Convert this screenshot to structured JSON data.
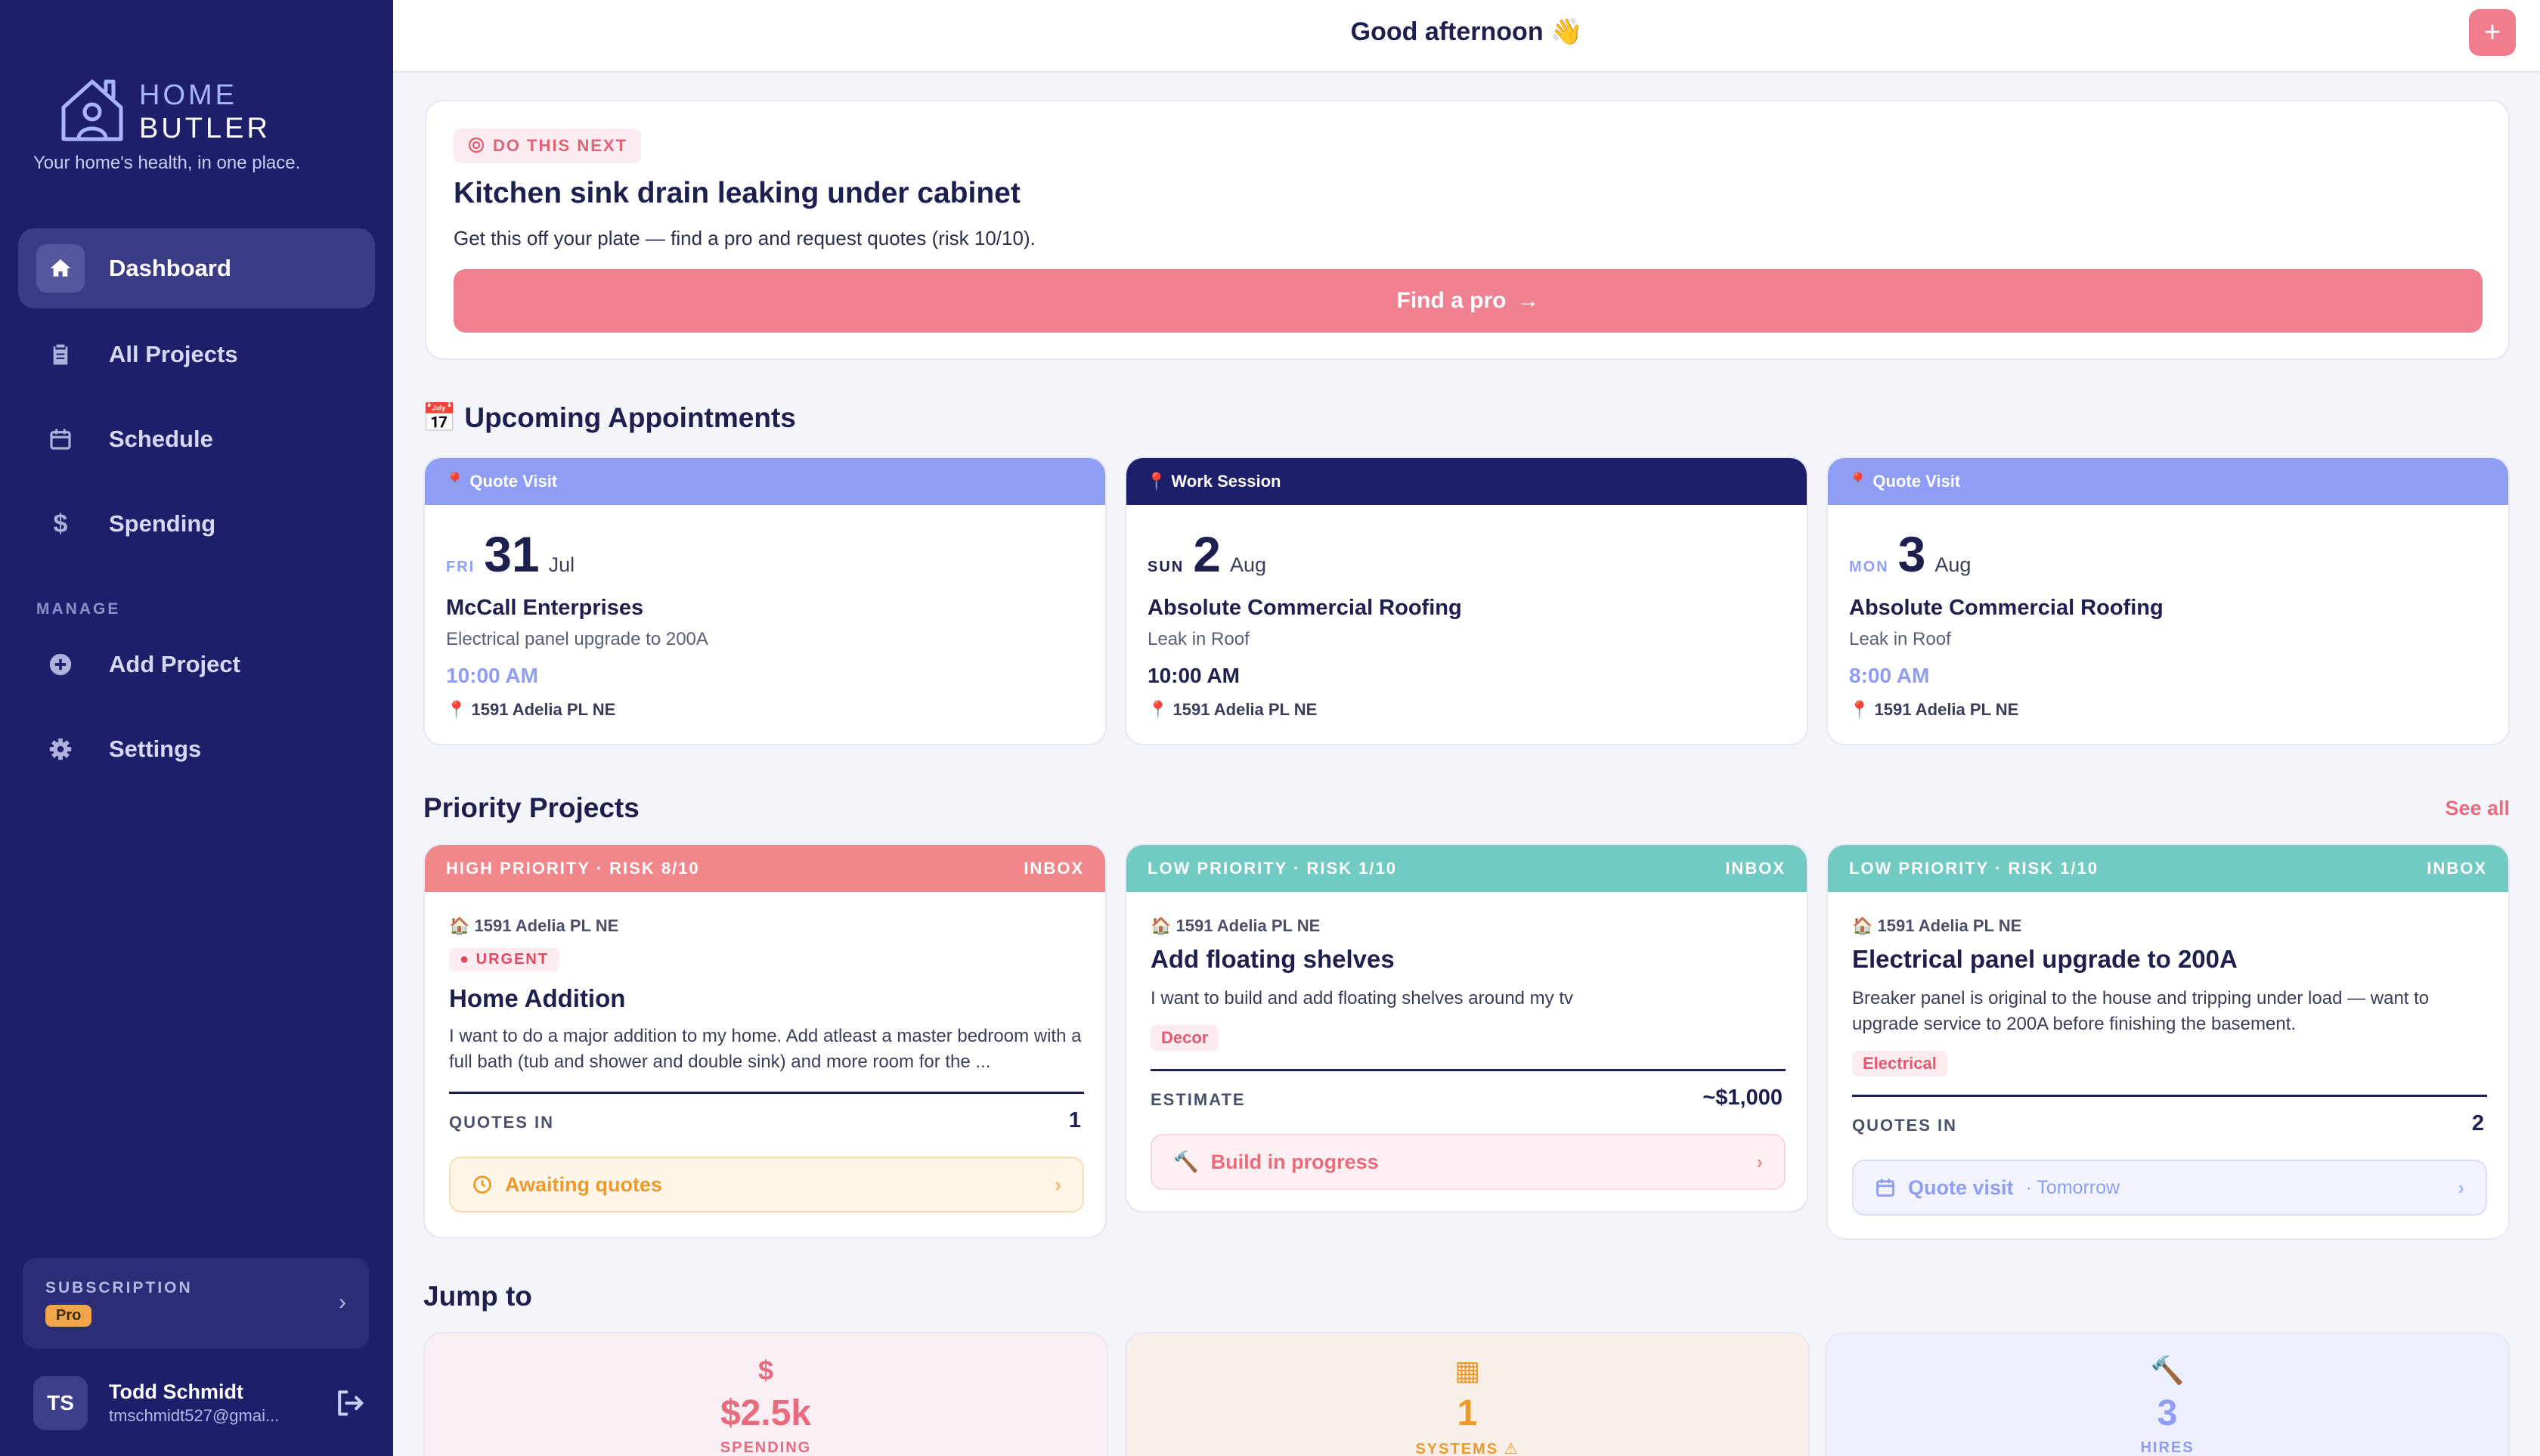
{
  "brand": {
    "line1": "HOME",
    "line2": "BUTLER",
    "tagline": "Your home's health, in one place."
  },
  "nav": {
    "items": [
      {
        "label": "Dashboard",
        "icon": "home-icon"
      },
      {
        "label": "All Projects",
        "icon": "clipboard-icon"
      },
      {
        "label": "Schedule",
        "icon": "calendar-icon"
      },
      {
        "label": "Spending",
        "icon": "dollar-icon"
      }
    ],
    "manage_label": "MANAGE",
    "manage_items": [
      {
        "label": "Add Project",
        "icon": "plus-circle-icon"
      },
      {
        "label": "Settings",
        "icon": "gear-icon"
      }
    ]
  },
  "subscription": {
    "title": "SUBSCRIPTION",
    "plan": "Pro"
  },
  "user": {
    "initials": "TS",
    "name": "Todd Schmidt",
    "email": "tmschmidt527@gmai..."
  },
  "header": {
    "greeting": "Good afternoon 👋",
    "add_label": "+"
  },
  "next": {
    "chip": "DO THIS NEXT",
    "title": "Kitchen sink drain leaking under cabinet",
    "description": "Get this off your plate — find a pro and request quotes (risk 10/10).",
    "button": "Find a pro",
    "button_arrow": "→"
  },
  "appointments": {
    "title": "📅 Upcoming Appointments",
    "items": [
      {
        "type": "Quote Visit",
        "dow": "FRI",
        "day": "31",
        "month": "Jul",
        "company": "McCall Enterprises",
        "project": "Electrical panel upgrade to 200A",
        "time": "10:00 AM",
        "address": "1591 Adelia PL NE"
      },
      {
        "type": "Work Session",
        "dow": "SUN",
        "day": "2",
        "month": "Aug",
        "company": "Absolute Commercial Roofing",
        "project": "Leak in Roof",
        "time": "10:00 AM",
        "address": "1591 Adelia PL NE"
      },
      {
        "type": "Quote Visit",
        "dow": "MON",
        "day": "3",
        "month": "Aug",
        "company": "Absolute Commercial Roofing",
        "project": "Leak in Roof",
        "time": "8:00 AM",
        "address": "1591 Adelia PL NE"
      }
    ]
  },
  "projects": {
    "title": "Priority Projects",
    "see_all": "See all",
    "items": [
      {
        "priority": "HIGH PRIORITY · RISK 8/10",
        "stage": "INBOX",
        "address": "1591 Adelia PL NE",
        "urgent": "URGENT",
        "title": "Home Addition",
        "description": "I want to do a major addition to my home. Add atleast a master bedroom with a full bath (tub and shower and double sink) and more room for the ...",
        "kv_label": "QUOTES IN",
        "kv_value": "1",
        "status": "Awaiting quotes"
      },
      {
        "priority": "LOW PRIORITY · RISK 1/10",
        "stage": "INBOX",
        "address": "1591 Adelia PL NE",
        "title": "Add floating shelves",
        "description": "I want to build and add floating shelves around my tv",
        "tag": "Decor",
        "kv_label": "ESTIMATE",
        "kv_value": "~$1,000",
        "status": "Build in progress"
      },
      {
        "priority": "LOW PRIORITY · RISK 1/10",
        "stage": "INBOX",
        "address": "1591 Adelia PL NE",
        "title": "Electrical panel upgrade to 200A",
        "description": "Breaker panel is original to the house and tripping under load — want to upgrade service to 200A before finishing the basement.",
        "tag": "Electrical",
        "kv_label": "QUOTES IN",
        "kv_value": "2",
        "status": "Quote visit",
        "status_extra": "· Tomorrow"
      }
    ]
  },
  "jump": {
    "title": "Jump to",
    "items": [
      {
        "icon": "$",
        "value": "$2.5k",
        "label": "SPENDING",
        "color": "#e86b7e"
      },
      {
        "icon": "▦",
        "value": "1",
        "label": "SYSTEMS ⚠",
        "color": "#ec9a2c"
      },
      {
        "icon": "🔨",
        "value": "3",
        "label": "HIRES",
        "color": "#8f9df5"
      }
    ]
  },
  "colors": {
    "sidebar": "#1e1f6b",
    "accent": "#ef7d8d",
    "teal": "#72cbc2",
    "periwinkle": "#8f9df5"
  }
}
